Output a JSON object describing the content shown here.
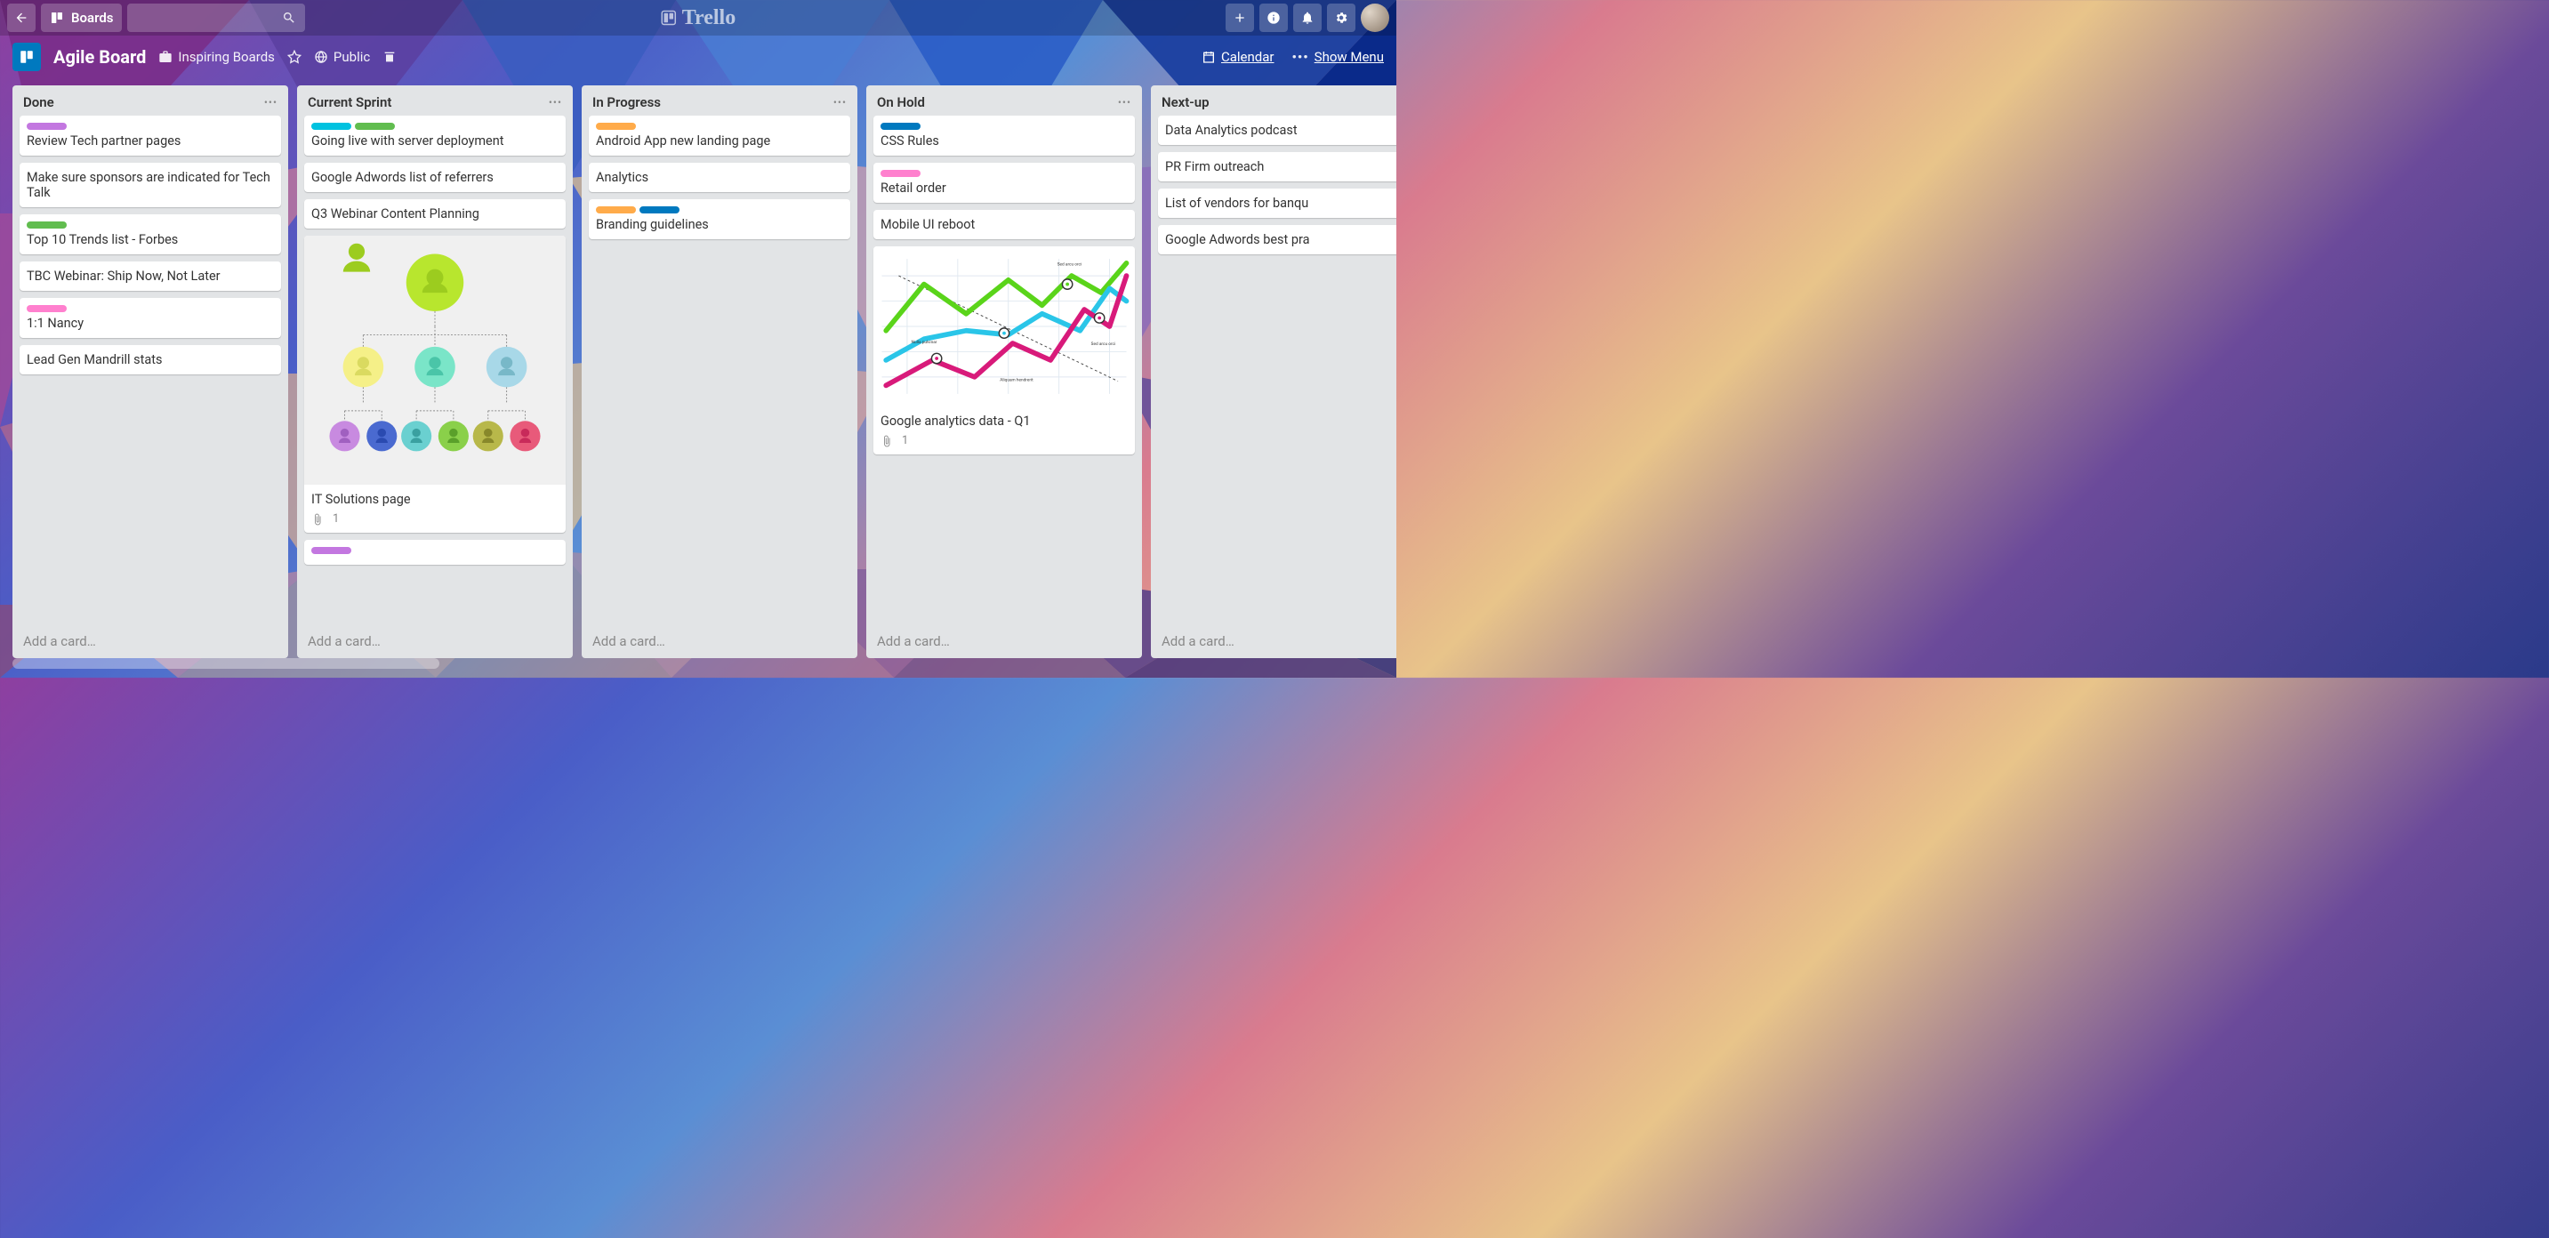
{
  "brand": "Trello",
  "header": {
    "boards_label": "Boards"
  },
  "board": {
    "title": "Agile Board",
    "inspiring": "Inspiring Boards",
    "visibility": "Public",
    "calendar": "Calendar",
    "show_menu": "Show Menu"
  },
  "lists": [
    {
      "title": "Done",
      "add": "Add a card…",
      "cards": [
        {
          "labels": [
            "#c377e0"
          ],
          "title": "Review Tech partner pages"
        },
        {
          "labels": [],
          "title": "Make sure sponsors are indicated for Tech Talk"
        },
        {
          "labels": [
            "#61bd4f"
          ],
          "title": "Top 10 Trends list - Forbes"
        },
        {
          "labels": [],
          "title": "TBC Webinar: Ship Now, Not Later"
        },
        {
          "labels": [
            "#ff80ce"
          ],
          "title": "1:1 Nancy"
        },
        {
          "labels": [],
          "title": "Lead Gen Mandrill stats"
        }
      ]
    },
    {
      "title": "Current Sprint",
      "add": "Add a card…",
      "cards": [
        {
          "labels": [
            "#00c2e0",
            "#61bd4f"
          ],
          "title": "Going live with server deployment"
        },
        {
          "labels": [],
          "title": "Google Adwords list of referrers"
        },
        {
          "labels": [],
          "title": "Q3 Webinar Content Planning"
        },
        {
          "labels": [],
          "title": "IT Solutions page",
          "cover": "orgchart",
          "attachments": 1
        },
        {
          "labels": [
            "#c377e0"
          ],
          "title": ""
        }
      ]
    },
    {
      "title": "In Progress",
      "add": "Add a card…",
      "cards": [
        {
          "labels": [
            "#ffab4a"
          ],
          "title": "Android App new landing page"
        },
        {
          "labels": [],
          "title": "Analytics"
        },
        {
          "labels": [
            "#ffab4a",
            "#0079bf"
          ],
          "title": "Branding guidelines"
        }
      ]
    },
    {
      "title": "On Hold",
      "add": "Add a card…",
      "cards": [
        {
          "labels": [
            "#0079bf"
          ],
          "title": "CSS Rules"
        },
        {
          "labels": [
            "#ff80ce"
          ],
          "title": "Retail order"
        },
        {
          "labels": [],
          "title": "Mobile UI reboot"
        },
        {
          "labels": [],
          "title": "Google analytics data - Q1",
          "cover": "chart",
          "attachments": 1
        }
      ]
    },
    {
      "title": "Next-up",
      "add": "Add a card…",
      "cards": [
        {
          "labels": [],
          "title": "Data Analytics podcast"
        },
        {
          "labels": [],
          "title": "PR Firm outreach"
        },
        {
          "labels": [],
          "title": "List of vendors for banqu"
        },
        {
          "labels": [],
          "title": "Google Adwords best pra"
        }
      ]
    }
  ]
}
